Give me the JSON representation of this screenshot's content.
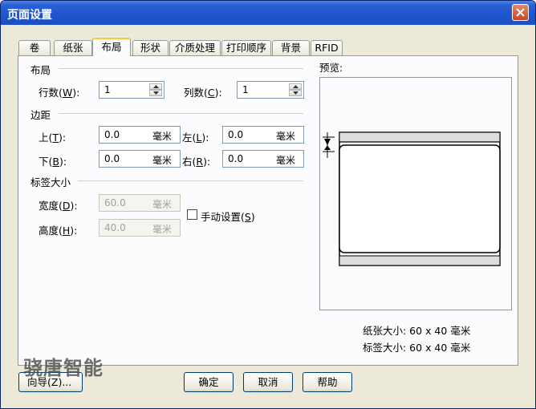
{
  "window": {
    "title": "页面设置"
  },
  "tabs": [
    "卷",
    "纸张",
    "布局",
    "形状",
    "介质处理",
    "打印顺序",
    "背景",
    "RFID"
  ],
  "active_tab": "布局",
  "layout_group": {
    "title": "布局",
    "rows": {
      "label": "行数(",
      "key": "W",
      "suffix": "):",
      "value": "1"
    },
    "cols": {
      "label": "列数(",
      "key": "C",
      "suffix": "):",
      "value": "1"
    }
  },
  "margin_group": {
    "title": "边距",
    "top": {
      "label": "上(",
      "key": "T",
      "suffix": "):",
      "value": "0.0",
      "unit": "毫米"
    },
    "left": {
      "label": "左(",
      "key": "L",
      "suffix": "):",
      "value": "0.0",
      "unit": "毫米"
    },
    "bottom": {
      "label": "下(",
      "key": "B",
      "suffix": "):",
      "value": "0.0",
      "unit": "毫米"
    },
    "right": {
      "label": "右(",
      "key": "R",
      "suffix": "):",
      "value": "0.0",
      "unit": "毫米"
    }
  },
  "size_group": {
    "title": "标签大小",
    "width": {
      "label": "宽度(",
      "key": "D",
      "suffix": "):",
      "value": "60.0",
      "unit": "毫米"
    },
    "height": {
      "label": "高度(",
      "key": "H",
      "suffix": "):",
      "value": "40.0",
      "unit": "毫米"
    },
    "manual": {
      "label": "手动设置(",
      "key": "S",
      "suffix": ")",
      "checked": false
    }
  },
  "preview": {
    "title": "预览:",
    "paper_size": "纸张大小: 60 x 40  毫米",
    "label_size": "标签大小: 60 x 40  毫米"
  },
  "buttons": {
    "wizard": "向导(Z)...",
    "ok": "确定",
    "cancel": "取消",
    "help": "帮助"
  },
  "watermark": "骁唐智能",
  "colors": {
    "titlebar": "#1f56cc",
    "tab_highlight": "#ffc83c",
    "dialog_bg": "#ece9d8"
  }
}
